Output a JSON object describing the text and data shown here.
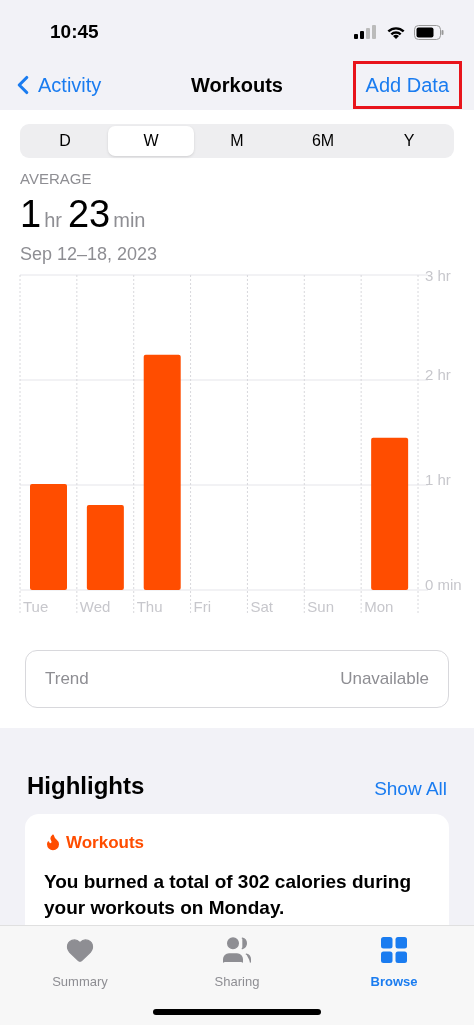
{
  "status_bar": {
    "time": "10:45"
  },
  "nav": {
    "back_label": "Activity",
    "title": "Workouts",
    "action": {
      "label": "Add Data",
      "highlighted": true
    }
  },
  "range_tabs": [
    {
      "label": "D",
      "selected": false
    },
    {
      "label": "W",
      "selected": true
    },
    {
      "label": "M",
      "selected": false
    },
    {
      "label": "6M",
      "selected": false
    },
    {
      "label": "Y",
      "selected": false
    }
  ],
  "summary": {
    "caption": "AVERAGE",
    "hours": "1",
    "hours_unit": "hr",
    "minutes": "23",
    "minutes_unit": "min",
    "date_range": "Sep 12–18, 2023"
  },
  "chart": {
    "chart_data": {
      "type": "bar",
      "categories": [
        "Tue",
        "Wed",
        "Thu",
        "Fri",
        "Sat",
        "Sun",
        "Mon"
      ],
      "series": [
        {
          "color": "#ff4d00",
          "values": [
            1.01,
            0.81,
            2.24,
            0,
            0,
            0,
            1.45
          ]
        }
      ],
      "ylim": [
        0,
        3
      ],
      "yticks": [
        {
          "value": 0,
          "label": "0 min"
        },
        {
          "value": 1,
          "label": "1 hr"
        },
        {
          "value": 2,
          "label": "2 hr"
        },
        {
          "value": 3,
          "label": "3 hr"
        }
      ]
    }
  },
  "trend": {
    "label": "Trend",
    "value": "Unavailable"
  },
  "highlights": {
    "title": "Highlights",
    "link": "Show All",
    "card": {
      "category": "Workouts",
      "text": "You burned a total of 302 calories during your workouts on Monday."
    }
  },
  "tab_bar": [
    {
      "label": "Summary",
      "selected": false
    },
    {
      "label": "Sharing",
      "selected": false
    },
    {
      "label": "Browse",
      "selected": true
    }
  ]
}
